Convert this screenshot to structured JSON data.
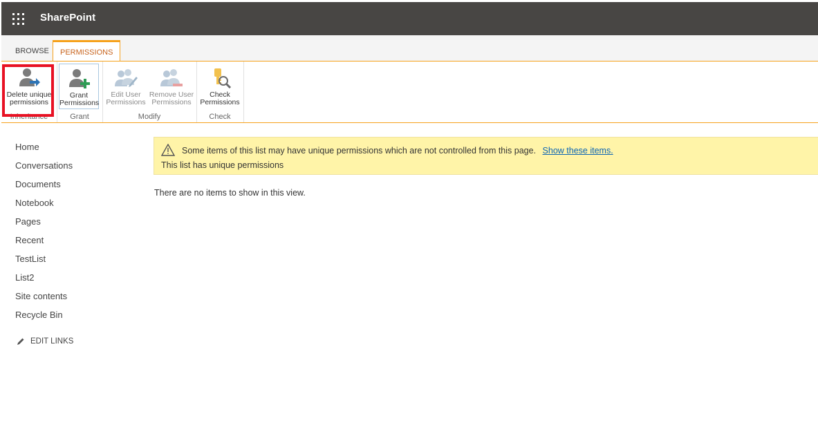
{
  "suite": {
    "title": "SharePoint"
  },
  "ribbon": {
    "tabs": [
      {
        "label": "BROWSE"
      },
      {
        "label": "PERMISSIONS"
      }
    ],
    "groups": {
      "inheritance": {
        "label": "Inheritance",
        "buttons": [
          {
            "line1": "Delete unique",
            "line2": "permissions"
          }
        ]
      },
      "grant": {
        "label": "Grant",
        "buttons": [
          {
            "line1": "Grant",
            "line2": "Permissions"
          }
        ]
      },
      "modify": {
        "label": "Modify",
        "buttons": [
          {
            "line1": "Edit User",
            "line2": "Permissions"
          },
          {
            "line1": "Remove User",
            "line2": "Permissions"
          }
        ]
      },
      "check": {
        "label": "Check",
        "buttons": [
          {
            "line1": "Check",
            "line2": "Permissions"
          }
        ]
      }
    }
  },
  "nav": {
    "items": [
      {
        "label": "Home"
      },
      {
        "label": "Conversations"
      },
      {
        "label": "Documents"
      },
      {
        "label": "Notebook"
      },
      {
        "label": "Pages"
      },
      {
        "label": "Recent"
      },
      {
        "label": "TestList"
      },
      {
        "label": "List2"
      },
      {
        "label": "Site contents"
      },
      {
        "label": "Recycle Bin"
      }
    ],
    "edit_links": "EDIT LINKS"
  },
  "notice": {
    "message": "Some items of this list may have unique permissions which are not controlled from this page.",
    "link": "Show these items.",
    "status": "This list has unique permissions"
  },
  "content": {
    "empty_message": "There are no items to show in this view."
  },
  "colors": {
    "suitebar": "#484644",
    "accent": "#f6a11b",
    "notice_bg": "#fff4a8",
    "highlight": "#e81123",
    "link": "#0a64b4"
  }
}
